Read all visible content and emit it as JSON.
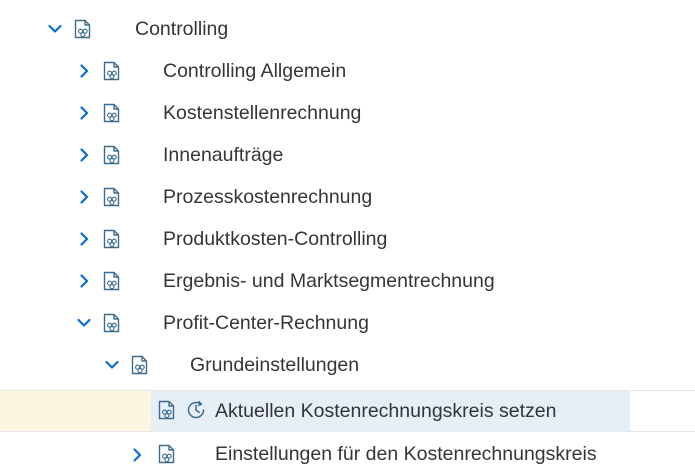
{
  "tree": {
    "nodes": [
      {
        "label": "Controlling",
        "state": "expanded",
        "level": 0,
        "icon": "folder-document-icon"
      },
      {
        "label": "Controlling Allgemein",
        "state": "collapsed",
        "level": 1,
        "icon": "folder-document-icon"
      },
      {
        "label": "Kostenstellenrechnung",
        "state": "collapsed",
        "level": 1,
        "icon": "folder-document-icon"
      },
      {
        "label": "Innenaufträge",
        "state": "collapsed",
        "level": 1,
        "icon": "folder-document-icon"
      },
      {
        "label": "Prozesskostenrechnung",
        "state": "collapsed",
        "level": 1,
        "icon": "folder-document-icon"
      },
      {
        "label": "Produktkosten-Controlling",
        "state": "collapsed",
        "level": 1,
        "icon": "folder-document-icon"
      },
      {
        "label": "Ergebnis- und Marktsegmentrechnung",
        "state": "collapsed",
        "level": 1,
        "icon": "folder-document-icon"
      },
      {
        "label": "Profit-Center-Rechnung",
        "state": "expanded",
        "level": 1,
        "icon": "folder-document-icon"
      },
      {
        "label": "Grundeinstellungen",
        "state": "expanded",
        "level": 2,
        "icon": "folder-document-icon"
      },
      {
        "label": "Aktuellen Kostenrechnungskreis setzen",
        "state": "leaf",
        "level": 3,
        "icon": "folder-document-icon",
        "action_icon": "clock-execute-icon",
        "selected": true
      },
      {
        "label": "Einstellungen für den Kostenrechnungskreis",
        "state": "collapsed",
        "level": 2,
        "icon": "folder-document-icon"
      }
    ]
  },
  "colors": {
    "text": "#32363a",
    "icon": "#3c6b8e",
    "expander": "#0a6ed1",
    "focus_background": "#fcf6e0",
    "selection_background": "#e6eef6"
  }
}
